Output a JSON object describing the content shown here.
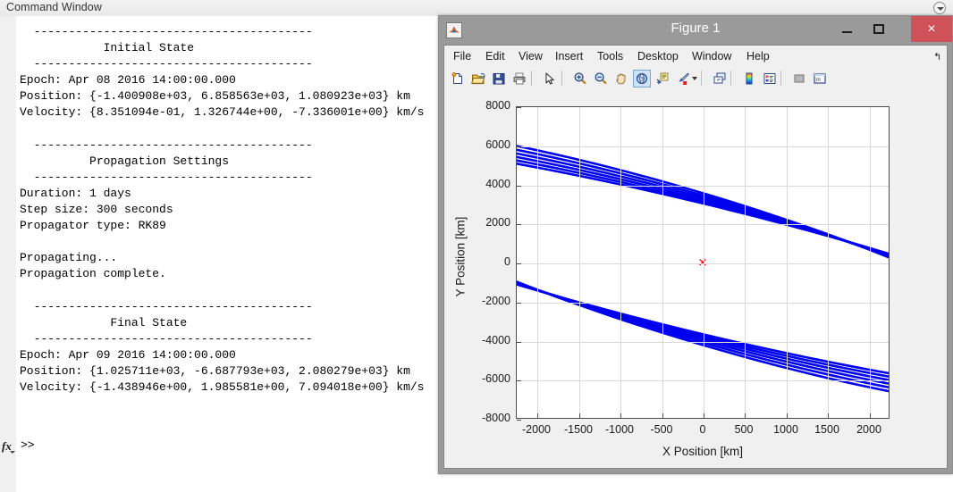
{
  "command_window": {
    "title": "Command Window",
    "dropdown_icon": "chevron-down-circle-icon",
    "output_text": "  ----------------------------------------\n            Initial State\n  ----------------------------------------\nEpoch: Apr 08 2016 14:00:00.000\nPosition: {-1.400908e+03, 6.858563e+03, 1.080923e+03} km\nVelocity: {8.351094e-01, 1.326744e+00, -7.336001e+00} km/s\n\n  ----------------------------------------\n          Propagation Settings\n  ----------------------------------------\nDuration: 1 days\nStep size: 300 seconds\nPropagator type: RK89\n\nPropagating...\nPropagation complete.\n\n  ----------------------------------------\n             Final State\n  ----------------------------------------\nEpoch: Apr 09 2016 14:00:00.000\nPosition: {1.025711e+03, -6.687793e+03, 2.080279e+03} km\nVelocity: {-1.438946e+00, 1.985581e+00, 7.094018e+00} km/s",
    "fx_badge": "fx",
    "prompt": ">>"
  },
  "figure_window": {
    "title": "Figure 1",
    "app_icon": "matlab-icon",
    "window_buttons": {
      "minimize": "minimize-icon",
      "maximize": "maximize-icon",
      "close": "×"
    },
    "menu": [
      {
        "label": "File",
        "x": 6
      },
      {
        "label": "Edit",
        "x": 42
      },
      {
        "label": "View",
        "x": 79
      },
      {
        "label": "Insert",
        "x": 120
      },
      {
        "label": "Tools",
        "x": 167
      },
      {
        "label": "Desktop",
        "x": 212
      },
      {
        "label": "Window",
        "x": 273
      },
      {
        "label": "Help",
        "x": 334
      }
    ],
    "menu_collapse_icon": "collapse-arrow-icon",
    "toolbar": [
      {
        "name": "new-figure-icon",
        "x": 5,
        "active": false
      },
      {
        "name": "open-file-icon",
        "x": 28,
        "active": false
      },
      {
        "name": "save-figure-icon",
        "x": 51,
        "active": false
      },
      {
        "name": "print-figure-icon",
        "x": 74,
        "active": false
      },
      {
        "name": "edit-plot-pointer-icon",
        "x": 108,
        "active": false
      },
      {
        "name": "zoom-in-icon",
        "x": 142,
        "active": false
      },
      {
        "name": "zoom-out-icon",
        "x": 165,
        "active": false
      },
      {
        "name": "pan-hand-icon",
        "x": 188,
        "active": false
      },
      {
        "name": "rotate-3d-icon",
        "x": 211,
        "active": true
      },
      {
        "name": "data-cursor-icon",
        "x": 234,
        "active": false
      },
      {
        "name": "brush-data-icon",
        "x": 257,
        "active": false
      },
      {
        "name": "link-data-icon",
        "x": 298,
        "active": false
      },
      {
        "name": "colorbar-icon",
        "x": 331,
        "active": false
      },
      {
        "name": "legend-icon",
        "x": 354,
        "active": false
      },
      {
        "name": "hide-plot-tools-icon",
        "x": 387,
        "active": false
      },
      {
        "name": "show-plot-tools-icon",
        "x": 410,
        "active": false
      }
    ],
    "toolbar_separators": [
      97,
      131,
      287,
      320,
      376
    ],
    "toolbar_caret_x": 277
  },
  "chart_data": {
    "type": "line",
    "title": "",
    "xlabel": "X Position [km]",
    "ylabel": "Y Position [km]",
    "xlim": [
      -2250,
      2250
    ],
    "ylim": [
      -8000,
      8000
    ],
    "xticks": [
      -2000,
      -1500,
      -1000,
      -500,
      0,
      500,
      1000,
      1500,
      2000
    ],
    "xticklabels": [
      "-2000",
      "-1500",
      "-1000",
      "-500",
      "0",
      "500",
      "1000",
      "1500",
      "2000"
    ],
    "yticks": [
      8000,
      6000,
      4000,
      2000,
      0,
      -2000,
      -4000,
      -6000,
      -8000
    ],
    "yticklabels": [
      "8000",
      "6000",
      "4000",
      "2000",
      "0",
      "-2000",
      "-4000",
      "-6000",
      "-8000"
    ],
    "grid": true,
    "legend": null,
    "series": [
      {
        "name": "orbit-track",
        "color": "#0000ee",
        "linewidth": 2.6,
        "description": "Precessing elliptical orbit track, 1 day propagation at 300 s steps",
        "ellipse": {
          "center_x": -60,
          "center_y": -260,
          "semi_major_km": 8500,
          "semi_minor_km": 2250,
          "rotation_deg": -58,
          "revolutions": 6,
          "precession_deg_per_rev": 1.5
        }
      },
      {
        "name": "central-body-marker",
        "color": "#ff0000",
        "marker": "x",
        "x": [
          0
        ],
        "y": [
          0
        ]
      }
    ]
  }
}
